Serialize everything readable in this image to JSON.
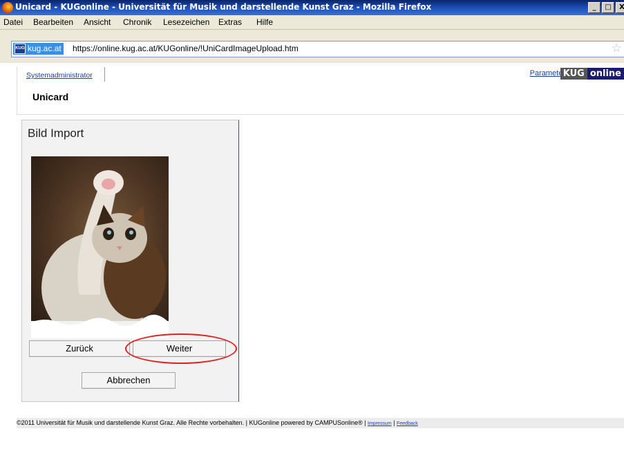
{
  "window": {
    "title": "Unicard - KUGonline - Universität für Musik und darstellende Kunst Graz - Mozilla Firefox",
    "buttons": [
      "_",
      "□",
      "X"
    ]
  },
  "menu": [
    "Datei",
    "Bearbeiten",
    "Ansicht",
    "Chronik",
    "Lesezeichen",
    "Extras",
    "Hilfe"
  ],
  "urlbar": {
    "site": "kug.ac.at",
    "url": "https://online.kug.ac.at/KUGonline/!UniCardImageUpload.htm",
    "star_icon": "bookmark-star-icon"
  },
  "header": {
    "nav_tab": "Systemadministrator",
    "page_title": "Unicard",
    "param_link": "Parameter",
    "logo_kug": "KUG",
    "logo_online": "online"
  },
  "panel": {
    "title": "Bild Import",
    "buttons": {
      "back": "Zurück",
      "next": "Weiter",
      "cancel": "Abbrechen"
    }
  },
  "footer": {
    "text": "©2011 Universität für Musik und darstellende Kunst Graz. Alle Rechte vorbehalten. | KUGonline powered by CAMPUSonline® | ",
    "impressum": "Impressum",
    "separator": " | ",
    "feedback": "Feedback"
  },
  "colors": {
    "link": "#1a3fa8",
    "highlight": "#e02020",
    "titlebar": "#0a246a"
  }
}
